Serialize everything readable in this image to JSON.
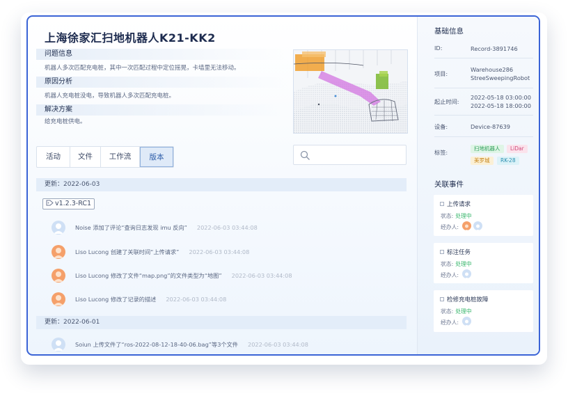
{
  "record": {
    "title": "上海徐家汇扫地机器人K21-KK2",
    "sections": [
      {
        "heading": "问题信息",
        "text": "机器人多次匹配充电桩，其中一次匹配过程中定位摇晃，卡墙里无法移动。"
      },
      {
        "heading": "原因分析",
        "text": "机器人充电桩没电，导致机器人多次匹配充电桩。"
      },
      {
        "heading": "解决方案",
        "text": "给充电桩供电。"
      }
    ]
  },
  "tabs": [
    {
      "label": "活动",
      "active": false
    },
    {
      "label": "文件",
      "active": false
    },
    {
      "label": "工作流",
      "active": false
    },
    {
      "label": "版本",
      "active": true
    }
  ],
  "search": {
    "placeholder": ""
  },
  "feed": {
    "groups": [
      {
        "date_label": "更新：2022-06-03",
        "version_tag": "v1.2.3-RC1",
        "items": [
          {
            "avatar": "blue",
            "text": "Noise 添加了评论“查询日志发现 imu 反向”",
            "time": "2022-06-03 03:44:08"
          },
          {
            "avatar": "orange",
            "text": "Liso Lucong 创建了关联时间“上传请求”",
            "time": "2022-06-03 03:44:08"
          },
          {
            "avatar": "orange",
            "text": "Liso Lucong 修改了文件“map.png”的文件类型为“地图”",
            "time": "2022-06-03 03:44:08"
          },
          {
            "avatar": "orange",
            "text": "Liso Lucong 修改了记录的描述",
            "time": "2022-06-03 03:44:08"
          }
        ]
      },
      {
        "date_label": "更新：2022-06-01",
        "items": [
          {
            "avatar": "blue",
            "text": "Soiun 上传文件了“ros-2022-08-12-18-40-06.bag”等3个文件",
            "time": "2022-06-03 03:44:08"
          }
        ]
      }
    ]
  },
  "sidebar": {
    "basic_heading": "基础信息",
    "fields": {
      "id_label": "ID:",
      "id_value": "Record-3891746",
      "project_label": "项目:",
      "project_line1": "Warehouse286",
      "project_line2": "StreeSweepingRobot",
      "time_label": "起止时间:",
      "time_start": "2022-05-18 03:00:00",
      "time_end": "2022-05-18 18:00:00",
      "device_label": "设备:",
      "device_value": "Device-87639",
      "tags_label": "标签:"
    },
    "tags": [
      {
        "label": "扫地机器人",
        "color": "#2e9e5a",
        "bg": "#dff5e6"
      },
      {
        "label": "LiDar",
        "color": "#d04a7a",
        "bg": "#fbe3ec"
      },
      {
        "label": "美罗城",
        "color": "#c7861c",
        "bg": "#fbf0d6"
      },
      {
        "label": "RK-28",
        "color": "#2a8fb0",
        "bg": "#dcf2f8"
      }
    ],
    "events_heading": "关联事件",
    "events": [
      {
        "title": "上传请求",
        "status_label": "状态:",
        "status_value": "处理中",
        "owner_label": "经办人:",
        "owners": [
          "orange",
          "blue"
        ]
      },
      {
        "title": "标注任务",
        "status_label": "状态:",
        "status_value": "处理中",
        "owner_label": "经办人:",
        "owners": [
          "blue"
        ]
      },
      {
        "title": "检修充电桩故障",
        "status_label": "状态:",
        "status_value": "处理中",
        "owner_label": "经办人:",
        "owners": [
          "blue"
        ]
      }
    ]
  },
  "colors": {
    "accent": "#3a63d6",
    "status_processing": "#35b56a",
    "active_tab_bg": "#dfeaf8"
  }
}
